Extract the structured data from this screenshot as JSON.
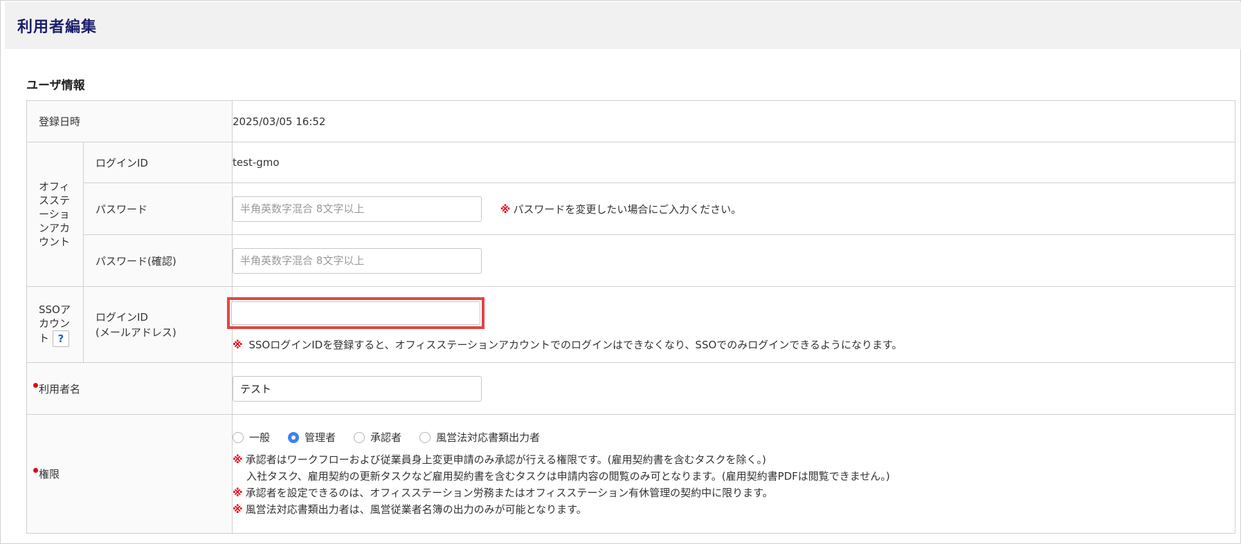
{
  "page": {
    "title": "利用者編集"
  },
  "section": {
    "title": "ユーザ情報"
  },
  "registered": {
    "label": "登録日時",
    "value": "2025/03/05 16:52"
  },
  "office_account": {
    "label": "オフィスステーションアカウント",
    "login_id": {
      "label": "ログインID",
      "value": "test-gmo"
    },
    "password": {
      "label": "パスワード",
      "placeholder": "半角英数字混合 8文字以上",
      "note": "パスワードを変更したい場合にご入力ください。"
    },
    "password_confirm": {
      "label": "パスワード(確認)",
      "placeholder": "半角英数字混合 8文字以上"
    }
  },
  "sso_account": {
    "label": "SSOアカウント",
    "help": "?",
    "login_id_label_1": "ログインID",
    "login_id_label_2": "(メールアドレス)",
    "value": "",
    "note": "SSOログインIDを登録すると、オフィスステーションアカウントでのログインはできなくなり、SSOでのみログインできるようになります。"
  },
  "user_name": {
    "label": "利用者名",
    "value": "テスト"
  },
  "permission": {
    "label": "権限",
    "options": [
      {
        "label": "一般",
        "checked": false
      },
      {
        "label": "管理者",
        "checked": true
      },
      {
        "label": "承認者",
        "checked": false
      },
      {
        "label": "風営法対応書類出力者",
        "checked": false
      }
    ],
    "notes": {
      "n1a": "承認者はワークフローおよび従業員身上変更申請のみ承認が行える権限です。(雇用契約書を含むタスクを除く。)",
      "n1b": "入社タスク、雇用契約の更新タスクなど雇用契約書を含むタスクは申請内容の閲覧のみ可となります。(雇用契約書PDFは閲覧できません。)",
      "n2": "承認者を設定できるのは、オフィスステーション労務またはオフィスステーション有休管理の契約中に限ります。",
      "n3": "風営法対応書類出力者は、風営従業者名簿の出力のみが可能となります。"
    }
  },
  "mark_symbol": "※",
  "colors": {
    "title": "#1a1f6b",
    "required": "#e60012",
    "highlight": "#e34444",
    "radio": "#3b82f6"
  }
}
